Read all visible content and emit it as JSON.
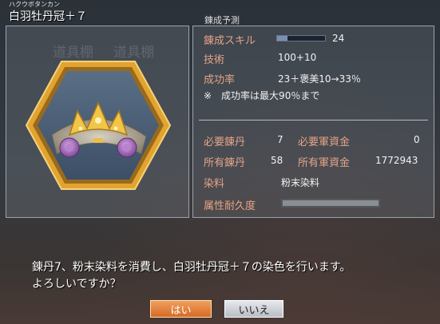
{
  "item": {
    "furigana": "ハクウボタンカン",
    "name": "白羽牡丹冠＋７"
  },
  "ghost_text": [
    "道具棚",
    "道具棚"
  ],
  "panel": {
    "section_title": "錬成予測",
    "skill_label": "錬成スキル",
    "skill_value": "24",
    "skill_bar_fraction": 0.22,
    "tech_label": "技術",
    "tech_value": "100+10",
    "rate_label": "成功率",
    "rate_value": "23＋褒美10→33％",
    "rate_note": "※　成功率は最大90％まで",
    "req_pill_label": "必要錬丹",
    "req_pill_value": "7",
    "req_funds_label": "必要軍資金",
    "req_funds_value": "0",
    "own_pill_label": "所有錬丹",
    "own_pill_value": "58",
    "own_funds_label": "所有軍資金",
    "own_funds_value": "1772943",
    "dye_label": "染料",
    "dye_value": "粉末染料",
    "durability_label": "属性耐久度"
  },
  "message": {
    "line1": "錬丹7、粉末染料を消費し、白羽牡丹冠＋７の染色を行います。",
    "line2": "よろしいですか？"
  },
  "buttons": {
    "yes": "はい",
    "no": "いいえ"
  },
  "colors": {
    "label": "#e4a386",
    "yes_button": "#e07a30"
  }
}
